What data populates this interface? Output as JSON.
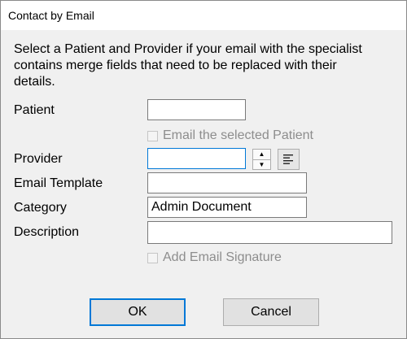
{
  "window": {
    "title": "Contact by Email"
  },
  "description": "Select a Patient and Provider if your email with the specialist contains merge fields that need to be replaced with their details.",
  "form": {
    "patient_label": "Patient",
    "patient_value": "",
    "email_patient_label": "Email the selected Patient",
    "provider_label": "Provider",
    "provider_value": "",
    "template_label": "Email Template",
    "template_value": "",
    "category_label": "Category",
    "category_value": "Admin Document",
    "description_label": "Description",
    "description_value": "",
    "signature_label": "Add Email Signature"
  },
  "buttons": {
    "ok": "OK",
    "cancel": "Cancel"
  },
  "icons": {
    "spin_up": "triangle-up-icon",
    "spin_down": "triangle-down-icon",
    "align": "align-left-icon"
  }
}
